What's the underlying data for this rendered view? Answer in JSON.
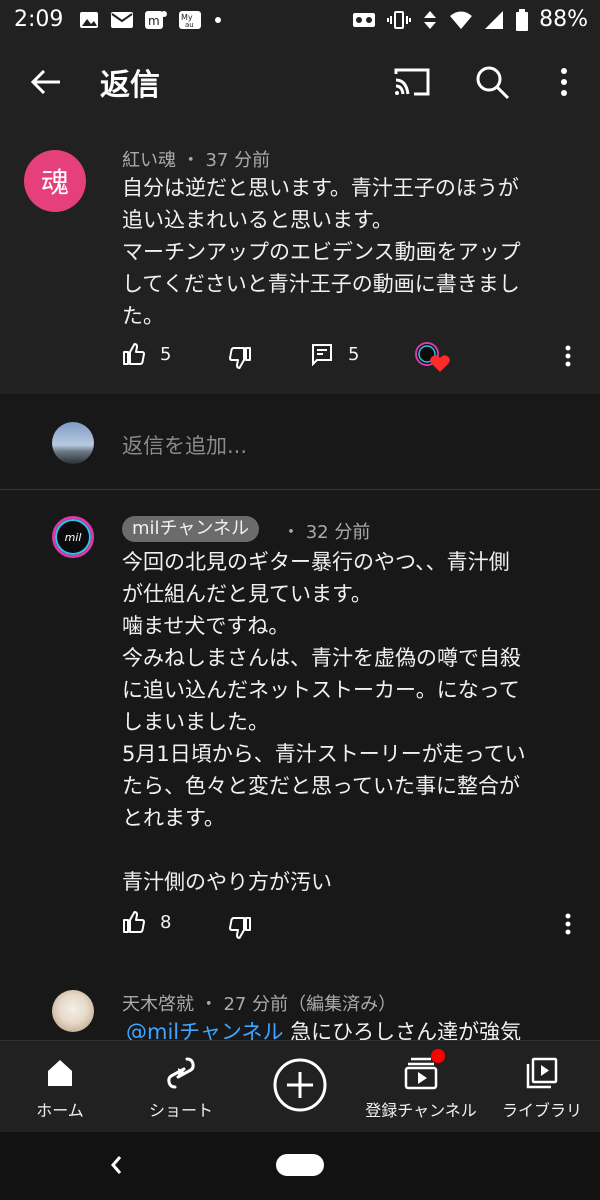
{
  "status_bar": {
    "time": "2:09",
    "battery": "88%",
    "left_icons": [
      "image-icon",
      "mail-icon",
      "m-app-icon",
      "my-au-icon",
      "dot-icon"
    ],
    "right_icons": [
      "voicemail-icon",
      "vibrate-icon",
      "data-arrows-icon",
      "wifi-icon",
      "signal-icon",
      "battery-icon"
    ]
  },
  "app_bar": {
    "title": "返信"
  },
  "parent_comment": {
    "avatar_char": "魂",
    "author": "紅い魂",
    "time": "37 分前",
    "lines": [
      "自分は逆だと思います。青汁王子のほうが",
      "追い込まれいると思います。",
      "マーチンアップのエビデンス動画をアップ",
      "してくださいと青汁王子の動画に書きまし",
      "た。"
    ],
    "like_count": "5",
    "reply_count": "5"
  },
  "add_reply": {
    "placeholder": "返信を追加..."
  },
  "replies": [
    {
      "author": "milチャンネル",
      "time": "32 分前",
      "avatar_text": "mil",
      "lines": [
        "今回の北見のギター暴行のやつ、、青汁側",
        "が仕組んだと見ています。",
        "噛ませ犬ですね。",
        "今みねしまさんは、青汁を虚偽の噂で自殺",
        "に追い込んだネットストーカー。になって",
        "しまいました。",
        "5月1日頃から、青汁ストーリーが走ってい",
        "たら、色々と変だと思っていた事に整合が",
        "とれます。",
        "",
        "青汁側のやり方が汚い"
      ],
      "like_count": "8"
    },
    {
      "author": "天木啓就",
      "time": "27 分前（編集済み）",
      "mention": "@milチャンネル",
      "text_start": "急にひろしさん達が強気"
    }
  ],
  "bottom_nav": {
    "items": [
      {
        "label": "ホーム"
      },
      {
        "label": "ショート"
      },
      {
        "label": "登録チャンネル"
      },
      {
        "label": "ライブラリ"
      }
    ]
  },
  "colors": {
    "background": "#181818",
    "surface": "#212121",
    "avatar_pink": "#e6407a",
    "link_blue": "#3ea6ff",
    "notification_red": "#ff0000"
  }
}
